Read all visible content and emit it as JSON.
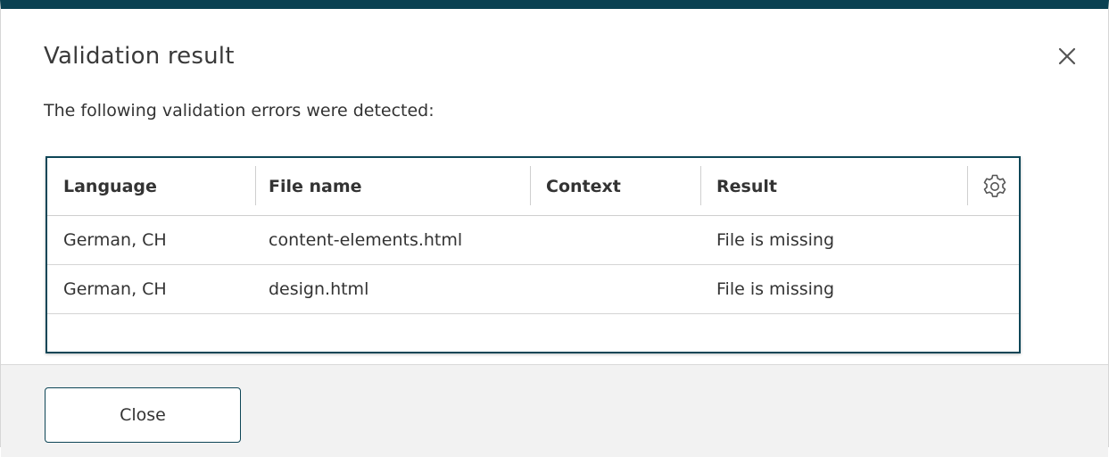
{
  "dialog": {
    "title": "Validation result",
    "message": "The following validation errors were detected:",
    "close_icon": "close-icon",
    "accent_color": "#0b4152"
  },
  "table": {
    "columns": [
      {
        "label": "Language"
      },
      {
        "label": "File name"
      },
      {
        "label": "Context"
      },
      {
        "label": "Result"
      }
    ],
    "settings_icon": "gear-icon",
    "rows": [
      {
        "language": "German, CH",
        "file_name": "content-elements.html",
        "context": "",
        "result": "File is missing"
      },
      {
        "language": "German, CH",
        "file_name": "design.html",
        "context": "",
        "result": "File is missing"
      }
    ]
  },
  "footer": {
    "close_label": "Close"
  }
}
